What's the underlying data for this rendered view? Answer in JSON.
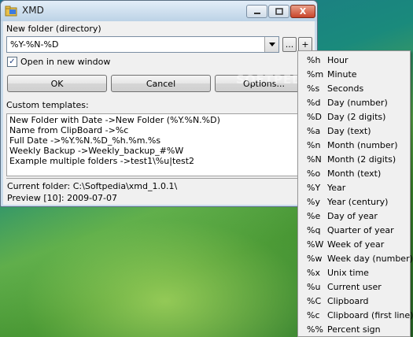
{
  "window": {
    "title": "XMD",
    "min_icon": "minimize-icon",
    "max_icon": "maximize-icon",
    "close_icon": "close-icon",
    "close_glyph": "X"
  },
  "form": {
    "new_folder_label": "New folder (directory)",
    "folder_value": "%Y-%N-%D",
    "dots_button": "...",
    "plus_button": "+",
    "open_checkbox_checked": true,
    "open_checkbox_label": "Open in new window",
    "ok_label": "OK",
    "cancel_label": "Cancel",
    "options_label": "Options...",
    "custom_templates_label": "Custom templates:"
  },
  "templates": [
    "New Folder with Date  ->New Folder (%Y.%N.%D)",
    "Name from ClipBoard  ->%c",
    "Full Date  ->%Y.%N.%D_%h.%m.%s",
    "Weekly Backup  ->Weekly_backup_#%W",
    "Example multiple folders  ->test1\\%u|test2"
  ],
  "status": {
    "current_folder": "Current folder: C:\\Softpedia\\xmd_1.0.1\\",
    "preview": "Preview [10]: 2009-07-07"
  },
  "menu": [
    {
      "code": "%h",
      "desc": "Hour"
    },
    {
      "code": "%m",
      "desc": "Minute"
    },
    {
      "code": "%s",
      "desc": "Seconds"
    },
    {
      "code": "%d",
      "desc": "Day (number)"
    },
    {
      "code": "%D",
      "desc": "Day (2 digits)"
    },
    {
      "code": "%a",
      "desc": "Day (text)"
    },
    {
      "code": "%n",
      "desc": "Month (number)"
    },
    {
      "code": "%N",
      "desc": "Month (2 digits)"
    },
    {
      "code": "%o",
      "desc": "Month (text)"
    },
    {
      "code": "%Y",
      "desc": "Year"
    },
    {
      "code": "%y",
      "desc": "Year (century)"
    },
    {
      "code": "%e",
      "desc": "Day of year"
    },
    {
      "code": "%q",
      "desc": "Quarter of year"
    },
    {
      "code": "%W",
      "desc": "Week of year"
    },
    {
      "code": "%w",
      "desc": "Week day (number)"
    },
    {
      "code": "%x",
      "desc": "Unix time"
    },
    {
      "code": "%u",
      "desc": "Current user"
    },
    {
      "code": "%C",
      "desc": "Clipboard"
    },
    {
      "code": "%c",
      "desc": "Clipboard (first line)"
    },
    {
      "code": "%%",
      "desc": "Percent sign"
    }
  ],
  "watermark": "SOFTPEDIA"
}
